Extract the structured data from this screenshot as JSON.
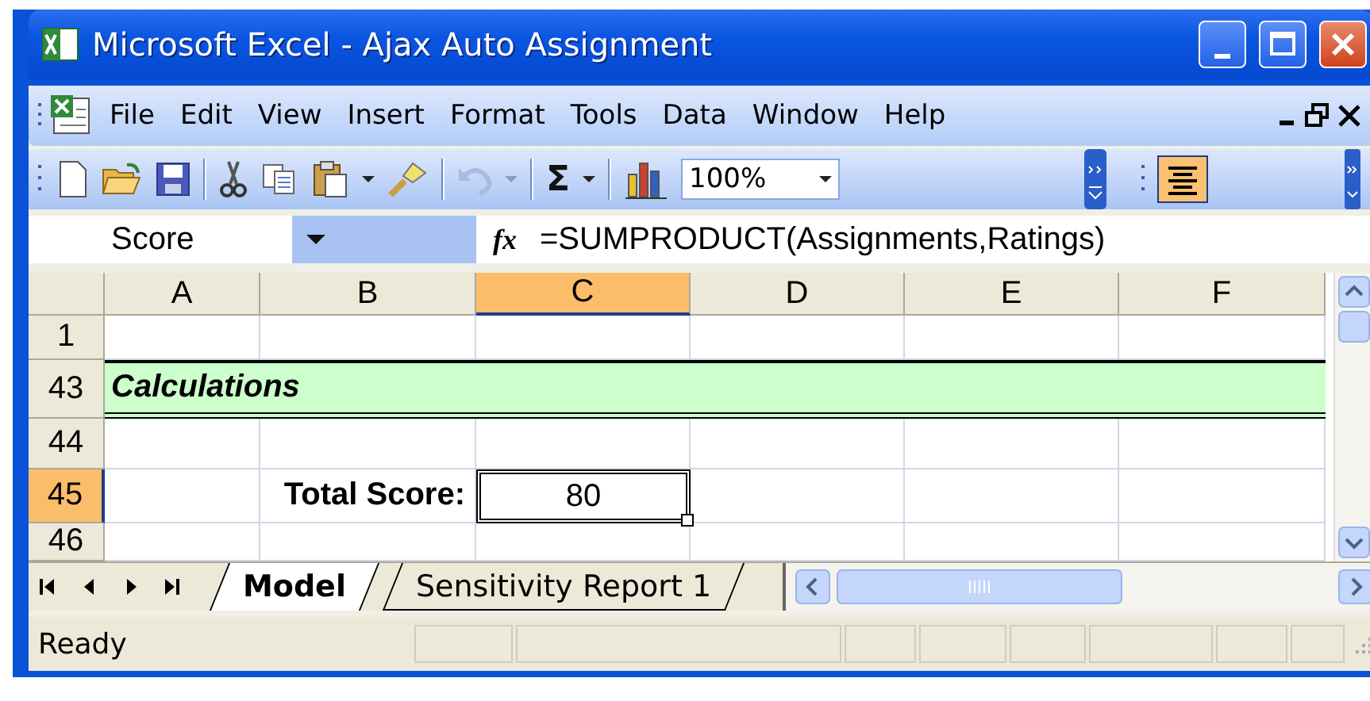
{
  "window": {
    "title": "Microsoft Excel - Ajax Auto Assignment"
  },
  "menu": [
    "File",
    "Edit",
    "View",
    "Insert",
    "Format",
    "Tools",
    "Data",
    "Window",
    "Help"
  ],
  "toolbar": {
    "autosum": "Σ",
    "zoom": "100%",
    "align_pressed": true
  },
  "formula_bar": {
    "name_box": "Score",
    "function_label": "fx",
    "formula": "=SUMPRODUCT(Assignments,Ratings)"
  },
  "sheet": {
    "columns": [
      {
        "label": "A",
        "selected": false
      },
      {
        "label": "B",
        "selected": false
      },
      {
        "label": "C",
        "selected": true
      },
      {
        "label": "D",
        "selected": false
      },
      {
        "label": "E",
        "selected": false
      },
      {
        "label": "F",
        "selected": false
      }
    ],
    "rows": [
      {
        "header": "1",
        "selected": false,
        "kind": "blank"
      },
      {
        "header": "43",
        "selected": false,
        "kind": "section",
        "title": "Calculations"
      },
      {
        "header": "44",
        "selected": false,
        "kind": "blank"
      },
      {
        "header": "45",
        "selected": true,
        "kind": "cells",
        "cells": [
          {
            "kind": "empty",
            "selected": false
          },
          {
            "kind": "label",
            "text": "Total Score:",
            "selected": false
          },
          {
            "kind": "value",
            "text": "80",
            "selected": true
          }
        ]
      },
      {
        "header": "46",
        "selected": false,
        "kind": "blank"
      }
    ]
  },
  "sheet_tabs": [
    {
      "label": "Model",
      "selected": true
    },
    {
      "label": "Sensitivity Report 1",
      "selected": false
    }
  ],
  "status_bar": {
    "text": "Ready"
  }
}
